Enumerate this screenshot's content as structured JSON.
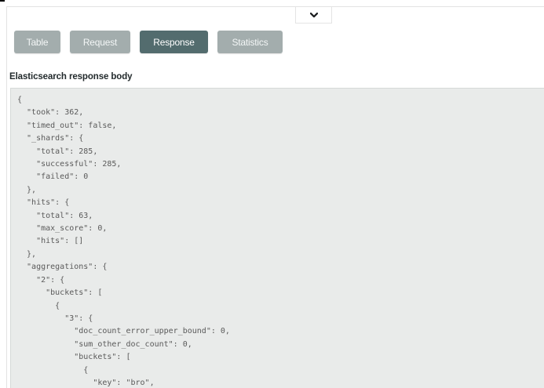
{
  "toggle": {
    "icon": "chevron-down-icon"
  },
  "tabs": [
    {
      "id": "table",
      "label": "Table",
      "active": false
    },
    {
      "id": "request",
      "label": "Request",
      "active": false
    },
    {
      "id": "response",
      "label": "Response",
      "active": true
    },
    {
      "id": "statistics",
      "label": "Statistics",
      "active": false
    }
  ],
  "section": {
    "title": "Elasticsearch response body"
  },
  "response_body": "{\n  \"took\": 362,\n  \"timed_out\": false,\n  \"_shards\": {\n    \"total\": 285,\n    \"successful\": 285,\n    \"failed\": 0\n  },\n  \"hits\": {\n    \"total\": 63,\n    \"max_score\": 0,\n    \"hits\": []\n  },\n  \"aggregations\": {\n    \"2\": {\n      \"buckets\": [\n        {\n          \"3\": {\n            \"doc_count_error_upper_bound\": 0,\n            \"sum_other_doc_count\": 0,\n            \"buckets\": [\n              {\n                \"key\": \"bro\",",
  "colors": {
    "tab_active_bg": "#536c6e",
    "tab_inactive_bg": "#a3adad",
    "code_panel_bg": "#e9ebea",
    "code_text": "#5a5a5a"
  }
}
